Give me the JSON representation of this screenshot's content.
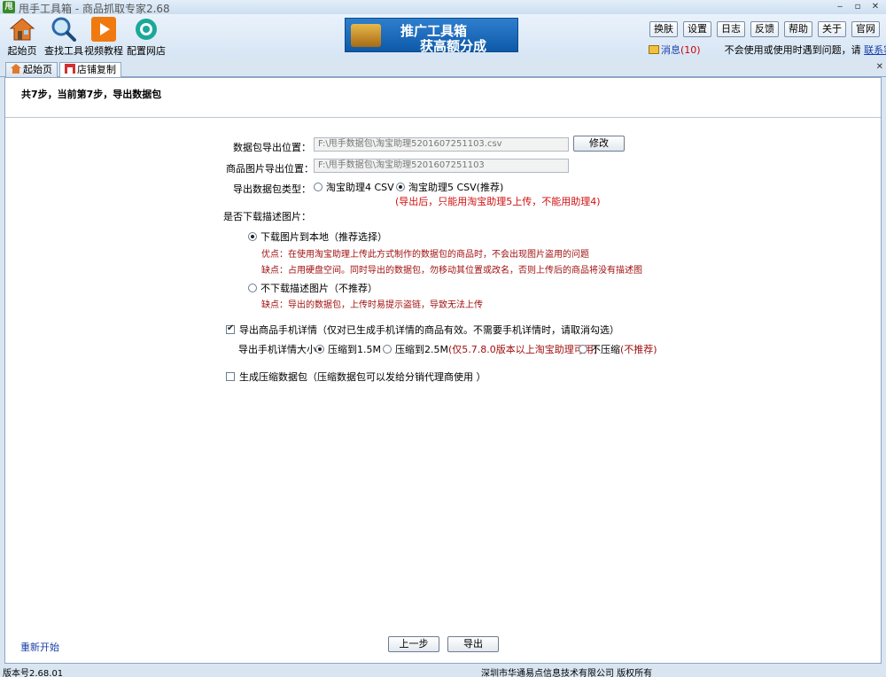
{
  "window": {
    "title": "甩手工具箱 - 商品抓取专家2.68",
    "app_icon_text": "甩",
    "controls": [
      "‒",
      "▫",
      "✕"
    ]
  },
  "toolbar": {
    "tools": [
      {
        "label": "起始页",
        "icon": "home-icon"
      },
      {
        "label": "查找工具",
        "icon": "magnifier-icon"
      },
      {
        "label": "视频教程",
        "icon": "play-icon"
      },
      {
        "label": "配置网店",
        "icon": "gear-icon"
      }
    ],
    "banner": {
      "line1": "推广工具箱",
      "line2": "获高额分成"
    },
    "buttons": [
      "换肤",
      "设置",
      "日志",
      "反馈",
      "帮助",
      "关于",
      "官网"
    ],
    "message_label": "消息",
    "message_count": "(10)",
    "help_text": "不会使用或使用时遇到问题，请",
    "support_link": "联系客服"
  },
  "tabs": [
    {
      "label": "起始页",
      "icon": "home-icon"
    },
    {
      "label": "店铺复制",
      "icon": "shop-icon",
      "active": true
    }
  ],
  "step_text": "共7步，当前第7步，导出数据包",
  "form": {
    "export_path_label": "数据包导出位置：",
    "export_path_value": "F:\\甩手数据包\\淘宝助理5201607251103.csv",
    "modify_button": "修改",
    "image_path_label": "商品图片导出位置：",
    "image_path_value": "F:\\甩手数据包\\淘宝助理5201607251103",
    "package_type_label": "导出数据包类型：",
    "type_option_1": "淘宝助理4 CSV",
    "type_option_2": "淘宝助理5 CSV(推荐)",
    "type_note": "(导出后，只能用淘宝助理5上传，不能用助理4)",
    "download_images_label": "是否下载描述图片：",
    "download_option_1": "下载图片到本地（推荐选择）",
    "pro_text": "优点：在使用淘宝助理上传此方式制作的数据包的商品时，不会出现图片盗用的问题",
    "con_text_1": "缺点：占用硬盘空间。同时导出的数据包，勿移动其位置或改名，否则上传后的商品将没有描述图",
    "download_option_2": "不下载描述图片（不推荐）",
    "con_text_2": "缺点：导出的数据包，上传时易提示盗链，导致无法上传",
    "mobile_detail_check": "导出商品手机详情（仅对已生成手机详情的商品有效。不需要手机详情时，请取消勾选）",
    "mobile_size_label": "导出手机详情大小：",
    "size_option_1": "压缩到1.5M",
    "size_option_2": "压缩到2.5M",
    "size_option_2_note": "(仅5.7.8.0版本以上淘宝助理可用)",
    "size_option_3": "不压缩",
    "size_option_3_note": "(不推荐)",
    "zip_check": "生成压缩数据包（压缩数据包可以发给分销代理商使用 ）"
  },
  "footer": {
    "restart_link": "重新开始",
    "prev_button": "上一步",
    "export_button": "导出"
  },
  "statusbar": {
    "version": "版本号2.68.01",
    "copyright": "深圳市华通易点信息技术有限公司 版权所有"
  }
}
